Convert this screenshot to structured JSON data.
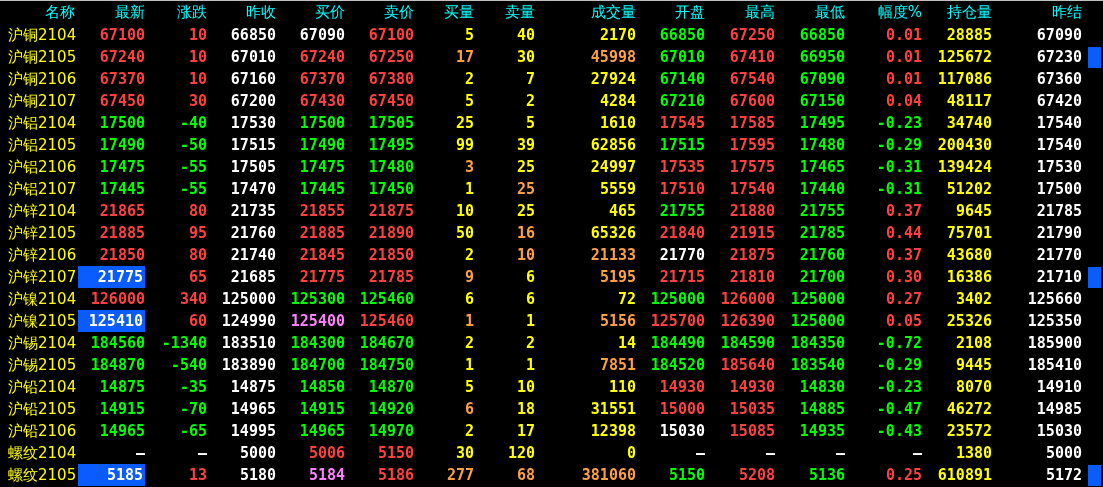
{
  "columns": [
    "名称",
    "最新",
    "涨跌",
    "昨收",
    "买价",
    "卖价",
    "买量",
    "卖量",
    "成交量",
    "开盘",
    "最高",
    "最低",
    "幅度%",
    "持仓量",
    "昨结"
  ],
  "rows": [
    {
      "name": "沪铜2104",
      "selected": false,
      "flagged": false,
      "cells": [
        {
          "text": "67100",
          "color": "#ff4040"
        },
        {
          "text": "10",
          "color": "#ff4040"
        },
        {
          "text": "66850",
          "color": "#ffffff"
        },
        {
          "text": "67090",
          "color": "#ffffff"
        },
        {
          "text": "67100",
          "color": "#ff4040"
        },
        {
          "text": "5",
          "color": "#ffff00"
        },
        {
          "text": "40",
          "color": "#ffff00"
        },
        {
          "text": "2170",
          "color": "#ffff00"
        },
        {
          "text": "66850",
          "color": "#00ff00"
        },
        {
          "text": "67250",
          "color": "#ff4040"
        },
        {
          "text": "66850",
          "color": "#00ff00"
        },
        {
          "text": "0.01",
          "color": "#ff4040"
        },
        {
          "text": "28885",
          "color": "#ffff00"
        },
        {
          "text": "67090",
          "color": "#ffffff"
        }
      ]
    },
    {
      "name": "沪铜2105",
      "selected": false,
      "flagged": true,
      "cells": [
        {
          "text": "67240",
          "color": "#ff4040"
        },
        {
          "text": "10",
          "color": "#ff4040"
        },
        {
          "text": "67010",
          "color": "#ffffff"
        },
        {
          "text": "67240",
          "color": "#ff4040"
        },
        {
          "text": "67250",
          "color": "#ff4040"
        },
        {
          "text": "17",
          "color": "#ffa040"
        },
        {
          "text": "30",
          "color": "#ffff00"
        },
        {
          "text": "45998",
          "color": "#ffa040"
        },
        {
          "text": "67010",
          "color": "#00ff00"
        },
        {
          "text": "67410",
          "color": "#ff4040"
        },
        {
          "text": "66950",
          "color": "#00ff00"
        },
        {
          "text": "0.01",
          "color": "#ff4040"
        },
        {
          "text": "125672",
          "color": "#ffff00"
        },
        {
          "text": "67230",
          "color": "#ffffff"
        }
      ]
    },
    {
      "name": "沪铜2106",
      "selected": false,
      "flagged": false,
      "cells": [
        {
          "text": "67370",
          "color": "#ff4040"
        },
        {
          "text": "10",
          "color": "#ff4040"
        },
        {
          "text": "67160",
          "color": "#ffffff"
        },
        {
          "text": "67370",
          "color": "#ff4040"
        },
        {
          "text": "67380",
          "color": "#ff4040"
        },
        {
          "text": "2",
          "color": "#ffff00"
        },
        {
          "text": "7",
          "color": "#ffff00"
        },
        {
          "text": "27924",
          "color": "#ffff00"
        },
        {
          "text": "67140",
          "color": "#00ff00"
        },
        {
          "text": "67540",
          "color": "#ff4040"
        },
        {
          "text": "67090",
          "color": "#00ff00"
        },
        {
          "text": "0.01",
          "color": "#ff4040"
        },
        {
          "text": "117086",
          "color": "#ffff00"
        },
        {
          "text": "67360",
          "color": "#ffffff"
        }
      ]
    },
    {
      "name": "沪铜2107",
      "selected": false,
      "flagged": false,
      "cells": [
        {
          "text": "67450",
          "color": "#ff4040"
        },
        {
          "text": "30",
          "color": "#ff4040"
        },
        {
          "text": "67200",
          "color": "#ffffff"
        },
        {
          "text": "67430",
          "color": "#ff4040"
        },
        {
          "text": "67450",
          "color": "#ff4040"
        },
        {
          "text": "5",
          "color": "#ffff00"
        },
        {
          "text": "2",
          "color": "#ffff00"
        },
        {
          "text": "4284",
          "color": "#ffff00"
        },
        {
          "text": "67210",
          "color": "#00ff00"
        },
        {
          "text": "67600",
          "color": "#ff4040"
        },
        {
          "text": "67150",
          "color": "#00ff00"
        },
        {
          "text": "0.04",
          "color": "#ff4040"
        },
        {
          "text": "48117",
          "color": "#ffff00"
        },
        {
          "text": "67420",
          "color": "#ffffff"
        }
      ]
    },
    {
      "name": "沪铝2104",
      "selected": false,
      "flagged": false,
      "cells": [
        {
          "text": "17500",
          "color": "#00ff00"
        },
        {
          "text": "-40",
          "color": "#00ff00"
        },
        {
          "text": "17530",
          "color": "#ffffff"
        },
        {
          "text": "17500",
          "color": "#00ff00"
        },
        {
          "text": "17505",
          "color": "#00ff00"
        },
        {
          "text": "25",
          "color": "#ffff00"
        },
        {
          "text": "5",
          "color": "#ffff00"
        },
        {
          "text": "1610",
          "color": "#ffff00"
        },
        {
          "text": "17545",
          "color": "#ff4040"
        },
        {
          "text": "17585",
          "color": "#ff4040"
        },
        {
          "text": "17495",
          "color": "#00ff00"
        },
        {
          "text": "-0.23",
          "color": "#00ff00"
        },
        {
          "text": "34740",
          "color": "#ffff00"
        },
        {
          "text": "17540",
          "color": "#ffffff"
        }
      ]
    },
    {
      "name": "沪铝2105",
      "selected": false,
      "flagged": false,
      "cells": [
        {
          "text": "17490",
          "color": "#00ff00"
        },
        {
          "text": "-50",
          "color": "#00ff00"
        },
        {
          "text": "17515",
          "color": "#ffffff"
        },
        {
          "text": "17490",
          "color": "#00ff00"
        },
        {
          "text": "17495",
          "color": "#00ff00"
        },
        {
          "text": "99",
          "color": "#ffff00"
        },
        {
          "text": "39",
          "color": "#ffff00"
        },
        {
          "text": "62856",
          "color": "#ffff00"
        },
        {
          "text": "17515",
          "color": "#00ff00"
        },
        {
          "text": "17595",
          "color": "#ff4040"
        },
        {
          "text": "17480",
          "color": "#00ff00"
        },
        {
          "text": "-0.29",
          "color": "#00ff00"
        },
        {
          "text": "200430",
          "color": "#ffff00"
        },
        {
          "text": "17540",
          "color": "#ffffff"
        }
      ]
    },
    {
      "name": "沪铝2106",
      "selected": false,
      "flagged": false,
      "cells": [
        {
          "text": "17475",
          "color": "#00ff00"
        },
        {
          "text": "-55",
          "color": "#00ff00"
        },
        {
          "text": "17505",
          "color": "#ffffff"
        },
        {
          "text": "17475",
          "color": "#00ff00"
        },
        {
          "text": "17480",
          "color": "#00ff00"
        },
        {
          "text": "3",
          "color": "#ffa040"
        },
        {
          "text": "25",
          "color": "#ffff00"
        },
        {
          "text": "24997",
          "color": "#ffff00"
        },
        {
          "text": "17535",
          "color": "#ff4040"
        },
        {
          "text": "17575",
          "color": "#ff4040"
        },
        {
          "text": "17465",
          "color": "#00ff00"
        },
        {
          "text": "-0.31",
          "color": "#00ff00"
        },
        {
          "text": "139424",
          "color": "#ffff00"
        },
        {
          "text": "17530",
          "color": "#ffffff"
        }
      ]
    },
    {
      "name": "沪铝2107",
      "selected": false,
      "flagged": false,
      "cells": [
        {
          "text": "17445",
          "color": "#00ff00"
        },
        {
          "text": "-55",
          "color": "#00ff00"
        },
        {
          "text": "17470",
          "color": "#ffffff"
        },
        {
          "text": "17445",
          "color": "#00ff00"
        },
        {
          "text": "17450",
          "color": "#00ff00"
        },
        {
          "text": "1",
          "color": "#ffff00"
        },
        {
          "text": "25",
          "color": "#ffa040"
        },
        {
          "text": "5559",
          "color": "#ffff00"
        },
        {
          "text": "17510",
          "color": "#ff4040"
        },
        {
          "text": "17540",
          "color": "#ff4040"
        },
        {
          "text": "17440",
          "color": "#00ff00"
        },
        {
          "text": "-0.31",
          "color": "#00ff00"
        },
        {
          "text": "51202",
          "color": "#ffff00"
        },
        {
          "text": "17500",
          "color": "#ffffff"
        }
      ]
    },
    {
      "name": "沪锌2104",
      "selected": false,
      "flagged": false,
      "cells": [
        {
          "text": "21865",
          "color": "#ff4040"
        },
        {
          "text": "80",
          "color": "#ff4040"
        },
        {
          "text": "21735",
          "color": "#ffffff"
        },
        {
          "text": "21855",
          "color": "#ff4040"
        },
        {
          "text": "21875",
          "color": "#ff4040"
        },
        {
          "text": "10",
          "color": "#ffff00"
        },
        {
          "text": "25",
          "color": "#ffff00"
        },
        {
          "text": "465",
          "color": "#ffff00"
        },
        {
          "text": "21755",
          "color": "#00ff00"
        },
        {
          "text": "21880",
          "color": "#ff4040"
        },
        {
          "text": "21755",
          "color": "#00ff00"
        },
        {
          "text": "0.37",
          "color": "#ff4040"
        },
        {
          "text": "9645",
          "color": "#ffff00"
        },
        {
          "text": "21785",
          "color": "#ffffff"
        }
      ]
    },
    {
      "name": "沪锌2105",
      "selected": false,
      "flagged": false,
      "cells": [
        {
          "text": "21885",
          "color": "#ff4040"
        },
        {
          "text": "95",
          "color": "#ff4040"
        },
        {
          "text": "21760",
          "color": "#ffffff"
        },
        {
          "text": "21885",
          "color": "#ff4040"
        },
        {
          "text": "21890",
          "color": "#ff4040"
        },
        {
          "text": "50",
          "color": "#ffff00"
        },
        {
          "text": "16",
          "color": "#ffa040"
        },
        {
          "text": "65326",
          "color": "#ffff00"
        },
        {
          "text": "21840",
          "color": "#ff4040"
        },
        {
          "text": "21915",
          "color": "#ff4040"
        },
        {
          "text": "21785",
          "color": "#00ff00"
        },
        {
          "text": "0.44",
          "color": "#ff4040"
        },
        {
          "text": "75701",
          "color": "#ffff00"
        },
        {
          "text": "21790",
          "color": "#ffffff"
        }
      ]
    },
    {
      "name": "沪锌2106",
      "selected": false,
      "flagged": false,
      "cells": [
        {
          "text": "21850",
          "color": "#ff4040"
        },
        {
          "text": "80",
          "color": "#ff4040"
        },
        {
          "text": "21740",
          "color": "#ffffff"
        },
        {
          "text": "21845",
          "color": "#ff4040"
        },
        {
          "text": "21850",
          "color": "#ff4040"
        },
        {
          "text": "2",
          "color": "#ffff00"
        },
        {
          "text": "10",
          "color": "#ffa040"
        },
        {
          "text": "21133",
          "color": "#ffa040"
        },
        {
          "text": "21770",
          "color": "#ffffff"
        },
        {
          "text": "21875",
          "color": "#ff4040"
        },
        {
          "text": "21760",
          "color": "#00ff00"
        },
        {
          "text": "0.37",
          "color": "#ff4040"
        },
        {
          "text": "43680",
          "color": "#ffff00"
        },
        {
          "text": "21770",
          "color": "#ffffff"
        }
      ]
    },
    {
      "name": "沪锌2107",
      "selected": true,
      "flagged": true,
      "cells": [
        {
          "text": "21775",
          "color": "#ffffff"
        },
        {
          "text": "65",
          "color": "#ff4040"
        },
        {
          "text": "21685",
          "color": "#ffffff"
        },
        {
          "text": "21775",
          "color": "#ff4040"
        },
        {
          "text": "21785",
          "color": "#ff4040"
        },
        {
          "text": "9",
          "color": "#ffa040"
        },
        {
          "text": "6",
          "color": "#ffff00"
        },
        {
          "text": "5195",
          "color": "#ffa040"
        },
        {
          "text": "21715",
          "color": "#ff4040"
        },
        {
          "text": "21810",
          "color": "#ff4040"
        },
        {
          "text": "21700",
          "color": "#00ff00"
        },
        {
          "text": "0.30",
          "color": "#ff4040"
        },
        {
          "text": "16386",
          "color": "#ffff00"
        },
        {
          "text": "21710",
          "color": "#ffffff"
        }
      ]
    },
    {
      "name": "沪镍2104",
      "selected": false,
      "flagged": false,
      "cells": [
        {
          "text": "126000",
          "color": "#ff4040"
        },
        {
          "text": "340",
          "color": "#ff4040"
        },
        {
          "text": "125000",
          "color": "#ffffff"
        },
        {
          "text": "125300",
          "color": "#00ff00"
        },
        {
          "text": "125460",
          "color": "#00ff00"
        },
        {
          "text": "6",
          "color": "#ffff00"
        },
        {
          "text": "6",
          "color": "#ffff00"
        },
        {
          "text": "72",
          "color": "#ffff00"
        },
        {
          "text": "125000",
          "color": "#00ff00"
        },
        {
          "text": "126000",
          "color": "#ff4040"
        },
        {
          "text": "125000",
          "color": "#00ff00"
        },
        {
          "text": "0.27",
          "color": "#ff4040"
        },
        {
          "text": "3402",
          "color": "#ffff00"
        },
        {
          "text": "125660",
          "color": "#ffffff"
        }
      ]
    },
    {
      "name": "沪镍2105",
      "selected": true,
      "flagged": false,
      "cells": [
        {
          "text": "125410",
          "color": "#ffffff"
        },
        {
          "text": "60",
          "color": "#ff4040"
        },
        {
          "text": "124990",
          "color": "#ffffff"
        },
        {
          "text": "125400",
          "color": "#ff80ff"
        },
        {
          "text": "125460",
          "color": "#ff4040"
        },
        {
          "text": "1",
          "color": "#ffa040"
        },
        {
          "text": "1",
          "color": "#ffff00"
        },
        {
          "text": "5156",
          "color": "#ffa040"
        },
        {
          "text": "125700",
          "color": "#ff4040"
        },
        {
          "text": "126390",
          "color": "#ff4040"
        },
        {
          "text": "125000",
          "color": "#00ff00"
        },
        {
          "text": "0.05",
          "color": "#ff4040"
        },
        {
          "text": "25326",
          "color": "#ffff00"
        },
        {
          "text": "125350",
          "color": "#ffffff"
        }
      ]
    },
    {
      "name": "沪锡2104",
      "selected": false,
      "flagged": false,
      "cells": [
        {
          "text": "184560",
          "color": "#00ff00"
        },
        {
          "text": "-1340",
          "color": "#00ff00"
        },
        {
          "text": "183510",
          "color": "#ffffff"
        },
        {
          "text": "184300",
          "color": "#00ff00"
        },
        {
          "text": "184670",
          "color": "#00ff00"
        },
        {
          "text": "2",
          "color": "#ffff00"
        },
        {
          "text": "2",
          "color": "#ffff00"
        },
        {
          "text": "14",
          "color": "#ffff00"
        },
        {
          "text": "184490",
          "color": "#00ff00"
        },
        {
          "text": "184590",
          "color": "#00ff00"
        },
        {
          "text": "184350",
          "color": "#00ff00"
        },
        {
          "text": "-0.72",
          "color": "#00ff00"
        },
        {
          "text": "2108",
          "color": "#ffff00"
        },
        {
          "text": "185900",
          "color": "#ffffff"
        }
      ]
    },
    {
      "name": "沪锡2105",
      "selected": false,
      "flagged": false,
      "cells": [
        {
          "text": "184870",
          "color": "#00ff00"
        },
        {
          "text": "-540",
          "color": "#00ff00"
        },
        {
          "text": "183890",
          "color": "#ffffff"
        },
        {
          "text": "184700",
          "color": "#00ff00"
        },
        {
          "text": "184750",
          "color": "#00ff00"
        },
        {
          "text": "1",
          "color": "#ffff00"
        },
        {
          "text": "1",
          "color": "#ffff00"
        },
        {
          "text": "7851",
          "color": "#ffa040"
        },
        {
          "text": "184520",
          "color": "#00ff00"
        },
        {
          "text": "185640",
          "color": "#ff4040"
        },
        {
          "text": "183540",
          "color": "#00ff00"
        },
        {
          "text": "-0.29",
          "color": "#00ff00"
        },
        {
          "text": "9445",
          "color": "#ffff00"
        },
        {
          "text": "185410",
          "color": "#ffffff"
        }
      ]
    },
    {
      "name": "沪铅2104",
      "selected": false,
      "flagged": false,
      "cells": [
        {
          "text": "14875",
          "color": "#00ff00"
        },
        {
          "text": "-35",
          "color": "#00ff00"
        },
        {
          "text": "14875",
          "color": "#ffffff"
        },
        {
          "text": "14850",
          "color": "#00ff00"
        },
        {
          "text": "14870",
          "color": "#00ff00"
        },
        {
          "text": "5",
          "color": "#ffff00"
        },
        {
          "text": "10",
          "color": "#ffff00"
        },
        {
          "text": "110",
          "color": "#ffff00"
        },
        {
          "text": "14930",
          "color": "#ff4040"
        },
        {
          "text": "14930",
          "color": "#ff4040"
        },
        {
          "text": "14830",
          "color": "#00ff00"
        },
        {
          "text": "-0.23",
          "color": "#00ff00"
        },
        {
          "text": "8070",
          "color": "#ffff00"
        },
        {
          "text": "14910",
          "color": "#ffffff"
        }
      ]
    },
    {
      "name": "沪铅2105",
      "selected": false,
      "flagged": false,
      "cells": [
        {
          "text": "14915",
          "color": "#00ff00"
        },
        {
          "text": "-70",
          "color": "#00ff00"
        },
        {
          "text": "14965",
          "color": "#ffffff"
        },
        {
          "text": "14915",
          "color": "#00ff00"
        },
        {
          "text": "14920",
          "color": "#00ff00"
        },
        {
          "text": "6",
          "color": "#ffa040"
        },
        {
          "text": "18",
          "color": "#ffff00"
        },
        {
          "text": "31551",
          "color": "#ffff00"
        },
        {
          "text": "15000",
          "color": "#ff4040"
        },
        {
          "text": "15035",
          "color": "#ff4040"
        },
        {
          "text": "14885",
          "color": "#00ff00"
        },
        {
          "text": "-0.47",
          "color": "#00ff00"
        },
        {
          "text": "46272",
          "color": "#ffff00"
        },
        {
          "text": "14985",
          "color": "#ffffff"
        }
      ]
    },
    {
      "name": "沪铅2106",
      "selected": false,
      "flagged": false,
      "cells": [
        {
          "text": "14965",
          "color": "#00ff00"
        },
        {
          "text": "-65",
          "color": "#00ff00"
        },
        {
          "text": "14995",
          "color": "#ffffff"
        },
        {
          "text": "14965",
          "color": "#00ff00"
        },
        {
          "text": "14970",
          "color": "#00ff00"
        },
        {
          "text": "2",
          "color": "#ffff00"
        },
        {
          "text": "17",
          "color": "#ffff00"
        },
        {
          "text": "12398",
          "color": "#ffff00"
        },
        {
          "text": "15030",
          "color": "#ffffff"
        },
        {
          "text": "15085",
          "color": "#ff4040"
        },
        {
          "text": "14935",
          "color": "#00ff00"
        },
        {
          "text": "-0.43",
          "color": "#00ff00"
        },
        {
          "text": "23572",
          "color": "#ffff00"
        },
        {
          "text": "15030",
          "color": "#ffffff"
        }
      ]
    },
    {
      "name": "螺纹2104",
      "selected": false,
      "flagged": false,
      "cells": [
        {
          "text": "—",
          "color": "#ffffff"
        },
        {
          "text": "—",
          "color": "#ffffff"
        },
        {
          "text": "5000",
          "color": "#ffffff"
        },
        {
          "text": "5006",
          "color": "#ff4040"
        },
        {
          "text": "5150",
          "color": "#ff4040"
        },
        {
          "text": "30",
          "color": "#ffff00"
        },
        {
          "text": "120",
          "color": "#ffff00"
        },
        {
          "text": "0",
          "color": "#ffff00"
        },
        {
          "text": "—",
          "color": "#ffffff"
        },
        {
          "text": "—",
          "color": "#ffffff"
        },
        {
          "text": "—",
          "color": "#ffffff"
        },
        {
          "text": "—",
          "color": "#ffffff"
        },
        {
          "text": "1380",
          "color": "#ffff00"
        },
        {
          "text": "5000",
          "color": "#ffffff"
        }
      ]
    },
    {
      "name": "螺纹2105",
      "selected": true,
      "flagged": true,
      "cells": [
        {
          "text": "5185",
          "color": "#ffffff"
        },
        {
          "text": "13",
          "color": "#ff4040"
        },
        {
          "text": "5180",
          "color": "#ffffff"
        },
        {
          "text": "5184",
          "color": "#ff80ff"
        },
        {
          "text": "5186",
          "color": "#ff4040"
        },
        {
          "text": "277",
          "color": "#ffa040"
        },
        {
          "text": "68",
          "color": "#ffa040"
        },
        {
          "text": "381060",
          "color": "#ffa040"
        },
        {
          "text": "5150",
          "color": "#00ff00"
        },
        {
          "text": "5208",
          "color": "#ff4040"
        },
        {
          "text": "5136",
          "color": "#00ff00"
        },
        {
          "text": "0.25",
          "color": "#ff4040"
        },
        {
          "text": "610891",
          "color": "#ffff00"
        },
        {
          "text": "5172",
          "color": "#ffffff"
        }
      ]
    }
  ]
}
